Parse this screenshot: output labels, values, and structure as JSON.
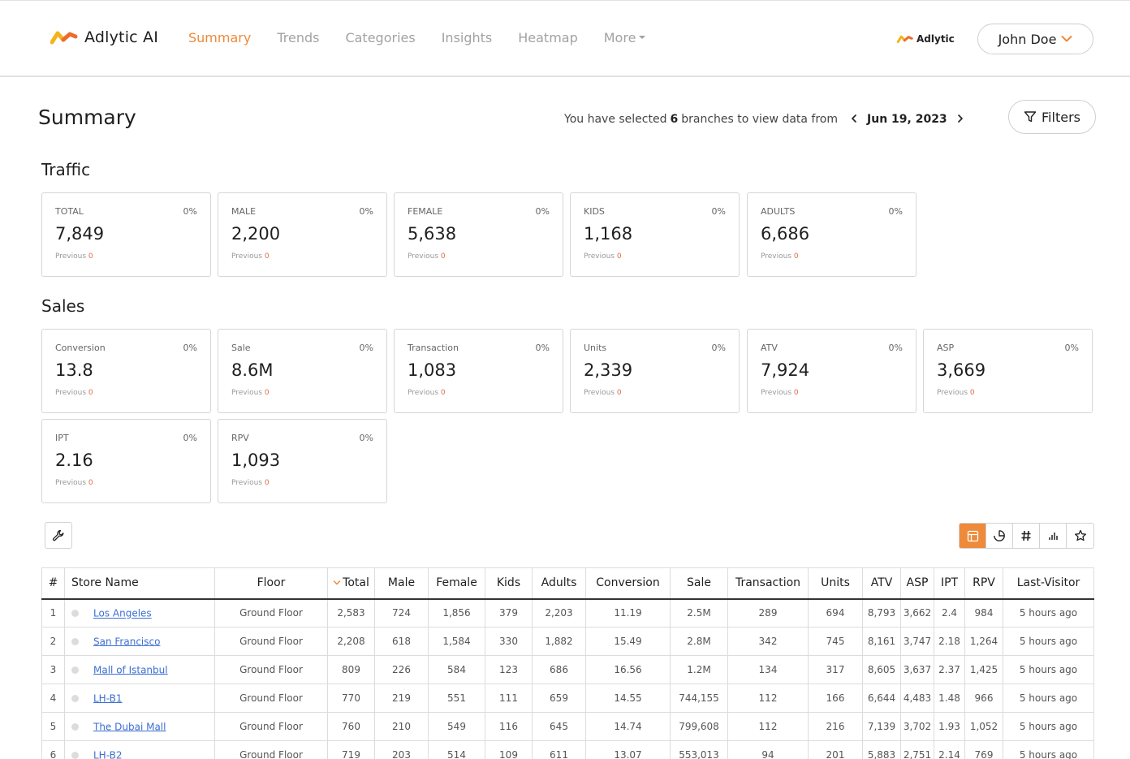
{
  "brand": {
    "name": "Adlytic AI",
    "mini_name": "Adlytic"
  },
  "nav": {
    "items": [
      {
        "label": "Summary",
        "active": true
      },
      {
        "label": "Trends"
      },
      {
        "label": "Categories"
      },
      {
        "label": "Insights"
      },
      {
        "label": "Heatmap"
      },
      {
        "label": "More"
      }
    ]
  },
  "user": {
    "name": "John Doe"
  },
  "header": {
    "title": "Summary",
    "selection_prefix": "You have selected",
    "selection_count": "6",
    "selection_suffix": "branches to view data from",
    "date": "Jun 19, 2023",
    "filters_label": "Filters"
  },
  "traffic": {
    "title": "Traffic",
    "cards": [
      {
        "label": "TOTAL",
        "pct": "0%",
        "value": "7,849",
        "prev_label": "Previous",
        "prev_value": "0"
      },
      {
        "label": "MALE",
        "pct": "0%",
        "value": "2,200",
        "prev_label": "Previous",
        "prev_value": "0"
      },
      {
        "label": "FEMALE",
        "pct": "0%",
        "value": "5,638",
        "prev_label": "Previous",
        "prev_value": "0"
      },
      {
        "label": "KIDS",
        "pct": "0%",
        "value": "1,168",
        "prev_label": "Previous",
        "prev_value": "0"
      },
      {
        "label": "ADULTS",
        "pct": "0%",
        "value": "6,686",
        "prev_label": "Previous",
        "prev_value": "0"
      }
    ]
  },
  "sales": {
    "title": "Sales",
    "cards": [
      {
        "label": "Conversion",
        "pct": "0%",
        "value": "13.8",
        "prev_label": "Previous",
        "prev_value": "0"
      },
      {
        "label": "Sale",
        "pct": "0%",
        "value": "8.6M",
        "prev_label": "Previous",
        "prev_value": "0"
      },
      {
        "label": "Transaction",
        "pct": "0%",
        "value": "1,083",
        "prev_label": "Previous",
        "prev_value": "0"
      },
      {
        "label": "Units",
        "pct": "0%",
        "value": "2,339",
        "prev_label": "Previous",
        "prev_value": "0"
      },
      {
        "label": "ATV",
        "pct": "0%",
        "value": "7,924",
        "prev_label": "Previous",
        "prev_value": "0"
      },
      {
        "label": "ASP",
        "pct": "0%",
        "value": "3,669",
        "prev_label": "Previous",
        "prev_value": "0"
      },
      {
        "label": "IPT",
        "pct": "0%",
        "value": "2.16",
        "prev_label": "Previous",
        "prev_value": "0"
      },
      {
        "label": "RPV",
        "pct": "0%",
        "value": "1,093",
        "prev_label": "Previous",
        "prev_value": "0"
      }
    ]
  },
  "table": {
    "headers": [
      "#",
      "Store Name",
      "Floor",
      "Total",
      "Male",
      "Female",
      "Kids",
      "Adults",
      "Conversion",
      "Sale",
      "Transaction",
      "Units",
      "ATV",
      "ASP",
      "IPT",
      "RPV",
      "Last-Visitor"
    ],
    "rows": [
      [
        "1",
        "Los Angeles",
        "Ground Floor",
        "2,583",
        "724",
        "1,856",
        "379",
        "2,203",
        "11.19",
        "2.5M",
        "289",
        "694",
        "8,793",
        "3,662",
        "2.4",
        "984",
        "5 hours ago"
      ],
      [
        "2",
        "San Francisco",
        "Ground Floor",
        "2,208",
        "618",
        "1,584",
        "330",
        "1,882",
        "15.49",
        "2.8M",
        "342",
        "745",
        "8,161",
        "3,747",
        "2.18",
        "1,264",
        "5 hours ago"
      ],
      [
        "3",
        "Mall of Istanbul",
        "Ground Floor",
        "809",
        "226",
        "584",
        "123",
        "686",
        "16.56",
        "1.2M",
        "134",
        "317",
        "8,605",
        "3,637",
        "2.37",
        "1,425",
        "5 hours ago"
      ],
      [
        "4",
        "LH-B1",
        "Ground Floor",
        "770",
        "219",
        "551",
        "111",
        "659",
        "14.55",
        "744,155",
        "112",
        "166",
        "6,644",
        "4,483",
        "1.48",
        "966",
        "5 hours ago"
      ],
      [
        "5",
        "The Dubai Mall",
        "Ground Floor",
        "760",
        "210",
        "549",
        "116",
        "645",
        "14.74",
        "799,608",
        "112",
        "216",
        "7,139",
        "3,702",
        "1.93",
        "1,052",
        "5 hours ago"
      ],
      [
        "6",
        "LH-B2",
        "Ground Floor",
        "719",
        "203",
        "514",
        "109",
        "611",
        "13.07",
        "553,013",
        "94",
        "201",
        "5,883",
        "2,751",
        "2.14",
        "769",
        "5 hours ago"
      ]
    ]
  },
  "icons": {
    "brand_logo": "adlytic-logo-icon",
    "filter": "funnel-icon",
    "wrench": "wrench-icon",
    "views": [
      "table-icon",
      "pie-chart-icon",
      "hash-icon",
      "bar-chart-icon",
      "star-icon"
    ]
  },
  "colors": {
    "accent": "#ee8a39",
    "link": "#3d6fd2",
    "previous_value": "#e06a4b"
  }
}
